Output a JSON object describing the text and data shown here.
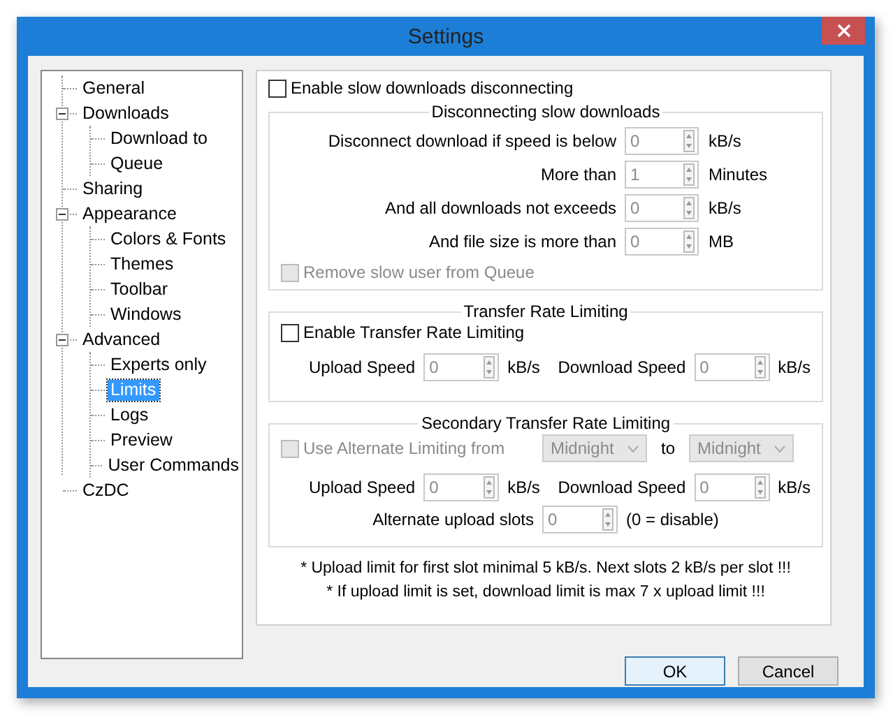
{
  "window": {
    "title": "Settings"
  },
  "tree": [
    {
      "label": "General",
      "selected": false
    },
    {
      "label": "Downloads",
      "selected": false,
      "expanded": true,
      "children": [
        {
          "label": "Download to",
          "selected": false
        },
        {
          "label": "Queue",
          "selected": false
        }
      ]
    },
    {
      "label": "Sharing",
      "selected": false
    },
    {
      "label": "Appearance",
      "selected": false,
      "expanded": true,
      "children": [
        {
          "label": "Colors & Fonts",
          "selected": false
        },
        {
          "label": "Themes",
          "selected": false
        },
        {
          "label": "Toolbar",
          "selected": false
        },
        {
          "label": "Windows",
          "selected": false
        }
      ]
    },
    {
      "label": "Advanced",
      "selected": false,
      "expanded": true,
      "children": [
        {
          "label": "Experts only",
          "selected": false
        },
        {
          "label": "Limits",
          "selected": true
        },
        {
          "label": "Logs",
          "selected": false
        },
        {
          "label": "Preview",
          "selected": false
        },
        {
          "label": "User Commands",
          "selected": false
        }
      ]
    },
    {
      "label": "CzDC",
      "selected": false
    }
  ],
  "slow_disconnect": {
    "checkbox": {
      "label": "Enable slow downloads disconnecting",
      "checked": false,
      "disabled": false
    },
    "group_title": "Disconnecting slow downloads",
    "rows": [
      {
        "label": "Disconnect download if speed is below",
        "value": "0",
        "unit": "kB/s",
        "disabled": true
      },
      {
        "label": "More than",
        "value": "1",
        "unit": "Minutes",
        "disabled": true
      },
      {
        "label": "And all downloads not exceeds",
        "value": "0",
        "unit": "kB/s",
        "disabled": true
      },
      {
        "label": "And file size is more than",
        "value": "0",
        "unit": "MB",
        "disabled": true
      }
    ],
    "remove_checkbox": {
      "label": "Remove slow user from Queue",
      "checked": false,
      "disabled": true
    }
  },
  "transfer": {
    "title": "Transfer Rate Limiting",
    "checkbox": {
      "label": "Enable Transfer Rate Limiting",
      "checked": false,
      "disabled": false
    },
    "upload": {
      "label": "Upload Speed",
      "value": "0",
      "unit": "kB/s",
      "disabled": true
    },
    "download": {
      "label": "Download Speed",
      "value": "0",
      "unit": "kB/s",
      "disabled": true
    }
  },
  "secondary": {
    "title": "Secondary Transfer Rate Limiting",
    "checkbox": {
      "label": "Use Alternate Limiting from",
      "checked": false,
      "disabled": true
    },
    "from": {
      "value": "Midnight",
      "disabled": true
    },
    "to_label": "to",
    "to": {
      "value": "Midnight",
      "disabled": true
    },
    "upload": {
      "label": "Upload Speed",
      "value": "0",
      "unit": "kB/s",
      "disabled": true
    },
    "download": {
      "label": "Download Speed",
      "value": "0",
      "unit": "kB/s",
      "disabled": true
    },
    "slots": {
      "label": "Alternate upload slots",
      "value": "0",
      "unit": "(0 = disable)",
      "disabled": true
    }
  },
  "notes": [
    "* Upload limit for first slot minimal 5 kB/s. Next slots 2 kB/s per slot !!!",
    "* If upload limit is set, download limit is max 7 x upload limit !!!"
  ],
  "buttons": [
    {
      "label": "OK",
      "default": true
    },
    {
      "label": "Cancel",
      "default": false
    }
  ]
}
